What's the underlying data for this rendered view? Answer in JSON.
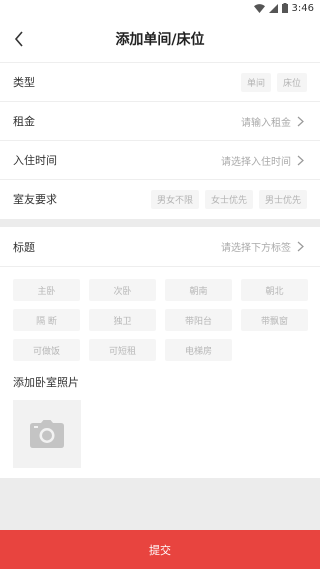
{
  "status_bar": {
    "time": "3:46"
  },
  "header": {
    "title": "添加单间/床位"
  },
  "form": {
    "type": {
      "label": "类型",
      "options": [
        "单间",
        "床位"
      ]
    },
    "rent": {
      "label": "租金",
      "placeholder": "请输入租金"
    },
    "move_in": {
      "label": "入住时间",
      "placeholder": "请选择入住时间"
    },
    "roommate": {
      "label": "室友要求",
      "options": [
        "男女不限",
        "女士优先",
        "男士优先"
      ]
    }
  },
  "tags_section": {
    "label": "标题",
    "placeholder": "请选择下方标签",
    "tags": [
      "主卧",
      "次卧",
      "朝南",
      "朝北",
      "隔 断",
      "独卫",
      "带阳台",
      "带飘窗",
      "可做饭",
      "可短租",
      "电梯房"
    ]
  },
  "photo": {
    "label": "添加卧室照片",
    "icon": "camera-icon"
  },
  "footer": {
    "submit_label": "提交"
  }
}
